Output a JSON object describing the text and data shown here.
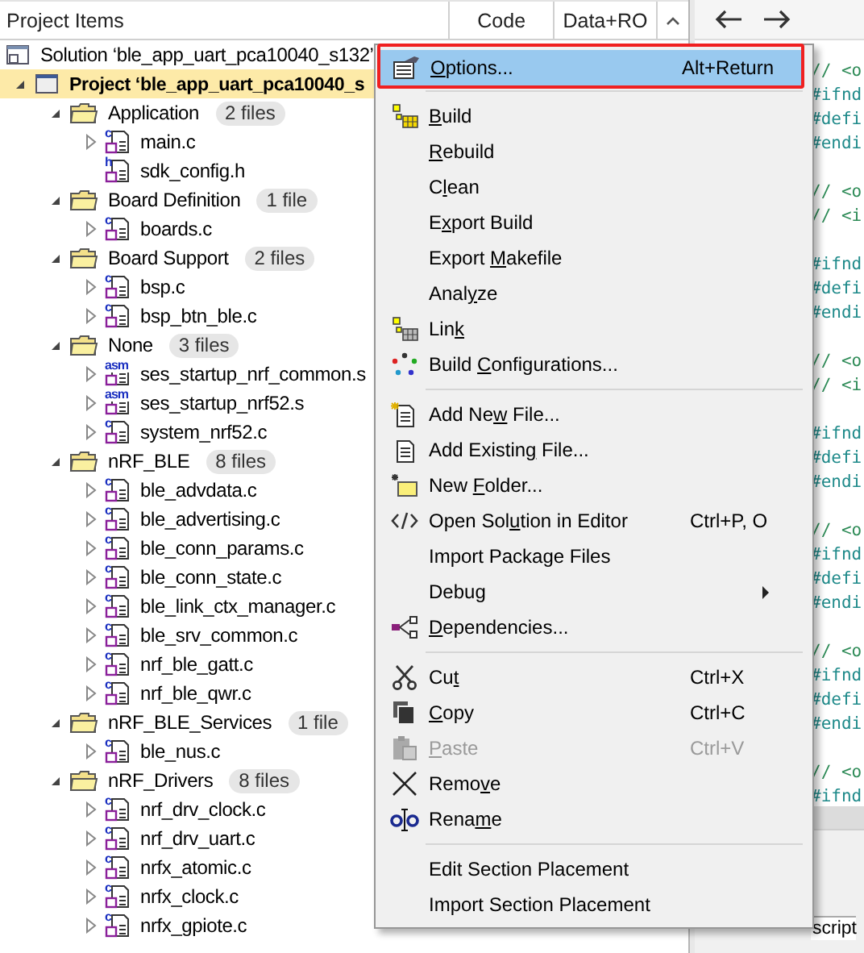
{
  "panel": {
    "title": "Project Items",
    "columns": [
      "Code",
      "Data+RO"
    ]
  },
  "tree": [
    {
      "kind": "solution",
      "label": "Solution ‘ble_app_uart_pca10040_s132’",
      "children": [
        {
          "kind": "project",
          "label": "Project ‘ble_app_uart_pca10040_s",
          "selected": true,
          "expanded": true,
          "children": [
            {
              "kind": "folder",
              "label": "Application",
              "count": "2 files",
              "expanded": true,
              "children": [
                {
                  "kind": "file",
                  "type": "c",
                  "label": "main.c",
                  "expanded": false
                },
                {
                  "kind": "file",
                  "type": "h",
                  "label": "sdk_config.h"
                }
              ]
            },
            {
              "kind": "folder",
              "label": "Board Definition",
              "count": "1 file",
              "expanded": true,
              "children": [
                {
                  "kind": "file",
                  "type": "c",
                  "label": "boards.c",
                  "expanded": false
                }
              ]
            },
            {
              "kind": "folder",
              "label": "Board Support",
              "count": "2 files",
              "expanded": true,
              "children": [
                {
                  "kind": "file",
                  "type": "c",
                  "label": "bsp.c",
                  "expanded": false
                },
                {
                  "kind": "file",
                  "type": "c",
                  "label": "bsp_btn_ble.c",
                  "expanded": false
                }
              ]
            },
            {
              "kind": "folder",
              "label": "None",
              "count": "3 files",
              "expanded": true,
              "children": [
                {
                  "kind": "file",
                  "type": "asm",
                  "label": "ses_startup_nrf_common.s",
                  "expanded": false
                },
                {
                  "kind": "file",
                  "type": "asm",
                  "label": "ses_startup_nrf52.s",
                  "expanded": false
                },
                {
                  "kind": "file",
                  "type": "c",
                  "label": "system_nrf52.c",
                  "expanded": false
                }
              ]
            },
            {
              "kind": "folder",
              "label": "nRF_BLE",
              "count": "8 files",
              "expanded": true,
              "children": [
                {
                  "kind": "file",
                  "type": "c",
                  "label": "ble_advdata.c",
                  "expanded": false
                },
                {
                  "kind": "file",
                  "type": "c",
                  "label": "ble_advertising.c",
                  "expanded": false
                },
                {
                  "kind": "file",
                  "type": "c",
                  "label": "ble_conn_params.c",
                  "expanded": false
                },
                {
                  "kind": "file",
                  "type": "c",
                  "label": "ble_conn_state.c",
                  "expanded": false
                },
                {
                  "kind": "file",
                  "type": "c",
                  "label": "ble_link_ctx_manager.c",
                  "expanded": false
                },
                {
                  "kind": "file",
                  "type": "c",
                  "label": "ble_srv_common.c",
                  "expanded": false
                },
                {
                  "kind": "file",
                  "type": "c",
                  "label": "nrf_ble_gatt.c",
                  "expanded": false
                },
                {
                  "kind": "file",
                  "type": "c",
                  "label": "nrf_ble_qwr.c",
                  "expanded": false
                }
              ]
            },
            {
              "kind": "folder",
              "label": "nRF_BLE_Services",
              "count": "1 file",
              "expanded": true,
              "children": [
                {
                  "kind": "file",
                  "type": "c",
                  "label": "ble_nus.c",
                  "expanded": false
                }
              ]
            },
            {
              "kind": "folder",
              "label": "nRF_Drivers",
              "count": "8 files",
              "expanded": true,
              "children": [
                {
                  "kind": "file",
                  "type": "c",
                  "label": "nrf_drv_clock.c",
                  "expanded": false
                },
                {
                  "kind": "file",
                  "type": "c",
                  "label": "nrf_drv_uart.c",
                  "expanded": false
                },
                {
                  "kind": "file",
                  "type": "c",
                  "label": "nrfx_atomic.c",
                  "expanded": false
                },
                {
                  "kind": "file",
                  "type": "c",
                  "label": "nrfx_clock.c",
                  "expanded": false
                },
                {
                  "kind": "file",
                  "type": "c",
                  "label": "nrfx_gpiote.c",
                  "expanded": false
                }
              ]
            }
          ]
        }
      ]
    }
  ],
  "editor": {
    "lines": [
      {
        "kind": "comment",
        "text": "// <o"
      },
      {
        "kind": "directive",
        "text": "#ifnd"
      },
      {
        "kind": "directive",
        "text": "#defi"
      },
      {
        "kind": "directive",
        "text": "#endi"
      },
      {
        "kind": "blank"
      },
      {
        "kind": "comment",
        "text": "// <o"
      },
      {
        "kind": "comment",
        "text": "// <i"
      },
      {
        "kind": "blank"
      },
      {
        "kind": "directive",
        "text": "#ifnd"
      },
      {
        "kind": "directive",
        "text": "#defi"
      },
      {
        "kind": "directive",
        "text": "#endi"
      },
      {
        "kind": "blank"
      },
      {
        "kind": "comment",
        "text": "// <o"
      },
      {
        "kind": "comment",
        "text": "// <i"
      },
      {
        "kind": "blank"
      },
      {
        "kind": "directive",
        "text": "#ifnd"
      },
      {
        "kind": "directive",
        "text": "#defi"
      },
      {
        "kind": "directive",
        "text": "#endi"
      },
      {
        "kind": "blank"
      },
      {
        "kind": "comment",
        "text": "// <o"
      },
      {
        "kind": "directive",
        "text": "#ifnd"
      },
      {
        "kind": "directive",
        "text": "#defi"
      },
      {
        "kind": "directive",
        "text": "#endi"
      },
      {
        "kind": "blank"
      },
      {
        "kind": "comment",
        "text": "// <o"
      },
      {
        "kind": "directive",
        "text": "#ifnd"
      },
      {
        "kind": "directive",
        "text": "#defi"
      },
      {
        "kind": "directive",
        "text": "#endi"
      },
      {
        "kind": "blank"
      },
      {
        "kind": "comment",
        "text": "// <o"
      },
      {
        "kind": "directive",
        "text": "#ifnd"
      }
    ]
  },
  "output_tab": {
    "label": "script"
  },
  "context_menu": {
    "items": [
      {
        "kind": "item",
        "key": "O",
        "rest": "ptions...",
        "shortcut": "Alt+Return",
        "selected": true,
        "disabled": false,
        "annotated": true
      },
      {
        "kind": "separator"
      },
      {
        "kind": "item",
        "key": "B",
        "rest": "uild",
        "selected": false,
        "disabled": false
      },
      {
        "kind": "item",
        "key": "R",
        "rest": "ebuild",
        "selected": false,
        "disabled": false
      },
      {
        "kind": "item",
        "label": "C",
        "key": "l",
        "rest": "ean",
        "selected": false,
        "disabled": false
      },
      {
        "kind": "item",
        "label": "E",
        "key": "x",
        "rest": "port Build",
        "selected": false,
        "disabled": false
      },
      {
        "kind": "item",
        "label": "Export ",
        "key": "M",
        "rest": "akefile",
        "selected": false,
        "disabled": false
      },
      {
        "kind": "item",
        "label": "Anal",
        "key": "y",
        "rest": "ze",
        "selected": false,
        "disabled": false
      },
      {
        "kind": "item",
        "label": "Lin",
        "key": "k",
        "selected": false,
        "disabled": false
      },
      {
        "kind": "item",
        "label": "Build ",
        "key": "C",
        "rest": "onfigurations...",
        "selected": false,
        "disabled": false
      },
      {
        "kind": "separator"
      },
      {
        "kind": "item",
        "label": "Add Ne",
        "key": "w",
        "rest": " File...",
        "selected": false,
        "disabled": false
      },
      {
        "kind": "item",
        "label": "Add Existin",
        "key": "g",
        "rest": " File...",
        "selected": false,
        "disabled": false
      },
      {
        "kind": "item",
        "label": "New ",
        "key": "F",
        "rest": "older...",
        "selected": false,
        "disabled": false
      },
      {
        "kind": "item",
        "label": "Open Sol",
        "key": "u",
        "rest": "tion in Editor",
        "shortcut": "Ctrl+P, O",
        "selected": false,
        "disabled": false
      },
      {
        "kind": "item",
        "label": "Import Package Files",
        "selected": false,
        "disabled": false
      },
      {
        "kind": "item",
        "label": "Debug",
        "submenu": true,
        "selected": false,
        "disabled": false
      },
      {
        "kind": "item",
        "key": "D",
        "rest": "ependencies...",
        "selected": false,
        "disabled": false
      },
      {
        "kind": "separator"
      },
      {
        "kind": "item",
        "label": "Cu",
        "key": "t",
        "shortcut": "Ctrl+X",
        "selected": false,
        "disabled": false
      },
      {
        "kind": "item",
        "key": "C",
        "rest": "opy",
        "shortcut": "Ctrl+C",
        "selected": false,
        "disabled": false
      },
      {
        "kind": "item",
        "key": "P",
        "rest": "aste",
        "shortcut": "Ctrl+V",
        "selected": false,
        "disabled": true
      },
      {
        "kind": "item",
        "label": "Remo",
        "key": "v",
        "rest": "e",
        "selected": false,
        "disabled": false
      },
      {
        "kind": "item",
        "label": "Rena",
        "key": "m",
        "rest": "e",
        "selected": false,
        "disabled": false
      },
      {
        "kind": "separator"
      },
      {
        "kind": "item",
        "label": "Edit Section Placement",
        "selected": false,
        "disabled": false
      },
      {
        "kind": "item",
        "label": "Import Section Placement",
        "selected": false,
        "disabled": false
      }
    ]
  }
}
